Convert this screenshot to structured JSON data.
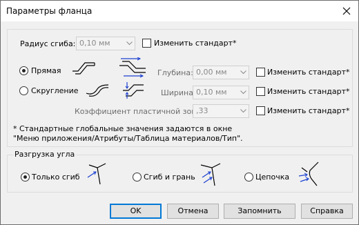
{
  "window": {
    "title": "Параметры фланца"
  },
  "bend_radius": {
    "label": "Радиус сгиба:",
    "value": "0,10 мм",
    "change_label": "Изменить стандарт*"
  },
  "bend_type": {
    "straight_label": "Прямая",
    "rounded_label": "Скругление",
    "selected": "straight"
  },
  "depth": {
    "label": "Глубина:",
    "value": "0,00 мм",
    "change_label": "Изменить стандарт*"
  },
  "width": {
    "label": "Ширина:",
    "value": "0,10 мм",
    "change_label": "Изменить стандарт*"
  },
  "k_factor": {
    "label": "Коэффициент пластичной зоны:",
    "value": ",33",
    "change_label": "Изменить стандарт*"
  },
  "note": {
    "line1": "* Стандартные глобальные значения задаются в окне",
    "line2": "\"Меню приложения/Атрибуты/Таблица материалов/Тип\"."
  },
  "corner_relief": {
    "legend": "Разгрузка угла",
    "option1": "Только сгиб",
    "option2": "Сгиб и грань",
    "option3": "Цепочка",
    "selected": "option1"
  },
  "buttons": {
    "ok": "OK",
    "cancel": "Отмена",
    "remember": "Запомнить",
    "help": "Справка"
  },
  "colors": {
    "accent": "#0078d7",
    "diagram_blue": "#1a3fd0"
  }
}
